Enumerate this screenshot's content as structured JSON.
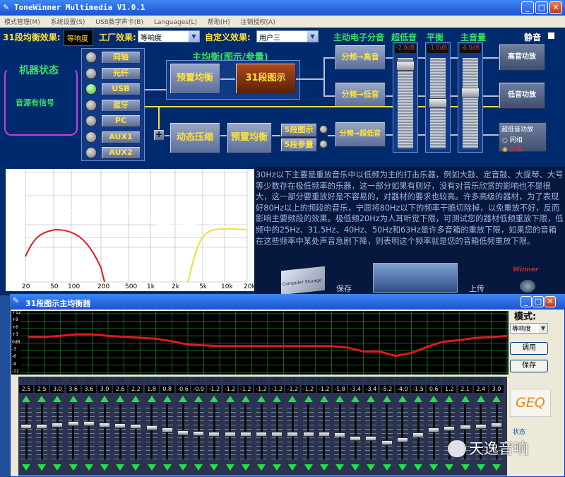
{
  "app": {
    "title": "ToneWinner Multimedia V1.0.1"
  },
  "menu": [
    "模式管理(M)",
    "系统设置(S)",
    "USB数字声卡(B)",
    "Languages(L)",
    "帮助(H)",
    "注销授权(A)"
  ],
  "top": {
    "eq31_label": "31段均衡效果:",
    "eq31_value": "等响度",
    "factory_label": "工厂效果:",
    "factory_value": "等响度",
    "custom_label": "自定义效果:",
    "custom_value": "用户三",
    "active_label": "主动电子分音",
    "subwoofer_label": "超低音",
    "balance_label": "平衡",
    "volume_label": "主音量",
    "mute_label": "静音"
  },
  "machine": {
    "title": "机器状态",
    "status": "音源有信号"
  },
  "sources": [
    {
      "label": "同轴",
      "active": false
    },
    {
      "label": "光纤",
      "active": false
    },
    {
      "label": "USB",
      "active": true
    },
    {
      "label": "蓝牙",
      "active": false
    },
    {
      "label": "PC",
      "active": false
    },
    {
      "label": "AUX1",
      "active": false
    },
    {
      "label": "AUX2",
      "active": false
    }
  ],
  "chain": {
    "main_eq_title": "主均衡(图示/参量)",
    "preset_eq": "预置均衡",
    "graphic31": "31段图示",
    "xover_high": "分频→高音",
    "xover_low": "分频→低音",
    "plus": "+",
    "compressor": "动态压缩",
    "preset_eq2": "预置均衡",
    "eq5_graphic": "5段图示",
    "eq5_param": "5段参量",
    "xover_sub": "分频→超低音"
  },
  "faders": {
    "sub_level": "-2.0dB",
    "bal_level": "-1.0dB",
    "vol_level": "-6.0dB"
  },
  "amps": {
    "high": "高音功放",
    "low": "低音功放",
    "sub_title": "超低音功放",
    "phase_in": "同相",
    "phase_rev": "反相"
  },
  "graph": {
    "ylabels": [
      "+10",
      "+5",
      "0",
      "-3",
      "-5",
      "-10"
    ],
    "ylabel_db": "dB",
    "xlabels": [
      "20",
      "50",
      "100",
      "200",
      "500",
      "1k",
      "2k",
      "5k",
      "10k",
      "20k"
    ],
    "xunit": "Hz"
  },
  "info_text": "30Hz以下主要是重放音乐中以低频为主的打击乐器，例如大鼓、定音鼓、大提琴、大号等少数存在极低频率的乐器，这一部分如果有则好，没有对音乐欣赏的影响也不是很大，这一部分要重放好是不容易的，对器材的要求也较高。许多高级的器材，为了表现好80Hz以上的频段的音乐，宁愿将80Hz以下的频率干脆切除掉，以免重放不好，反而影响主要频段的效果。极低频20Hz为人耳听觉下限，可测试您的器材低频重放下限，低频中的25Hz、31.5Hz、40Hz、50Hz和63Hz是许多音箱的重放下限，如果您的音箱在这些频率中某处声音急剧下降，则表明这个频率就是您的音箱低频重放下限。",
  "thumbs": {
    "caption": "Computer Storage",
    "brand": "Winner",
    "text1": "保存",
    "text2": "上传"
  },
  "dialog": {
    "title": "31段图示主均衡器",
    "mode_label": "模式:",
    "mode_value": "等响度",
    "btn_call": "调用",
    "btn_save": "保存",
    "geq": "GEQ",
    "status_label": "状态",
    "watermark": "天逸音响",
    "db_labels": [
      "+12",
      "+9",
      "+6",
      "+3",
      "0dB",
      "-3",
      "-6",
      "-9",
      "-12"
    ]
  },
  "eq_bands": [
    {
      "f": "22",
      "v": "2.5"
    },
    {
      "f": "27.5",
      "v": "2.5"
    },
    {
      "f": "34",
      "v": "3.0"
    },
    {
      "f": "43",
      "v": "3.6"
    },
    {
      "f": "54",
      "v": "3.6"
    },
    {
      "f": "67",
      "v": "3.0"
    },
    {
      "f": "84",
      "v": "2.6"
    },
    {
      "f": "105",
      "v": "2.2"
    },
    {
      "f": "132",
      "v": "1.8"
    },
    {
      "f": "165",
      "v": "0.8"
    },
    {
      "f": "202",
      "v": "-0.6"
    },
    {
      "f": "257",
      "v": "-0.9"
    },
    {
      "f": "322",
      "v": "-1.2"
    },
    {
      "f": "402",
      "v": "-1.2"
    },
    {
      "f": "503",
      "v": "-1.2"
    },
    {
      "f": "629",
      "v": "-1.2"
    },
    {
      "f": "787",
      "v": "-1.2"
    },
    {
      "f": "1K",
      "v": "-1.2"
    },
    {
      "f": "1.2K",
      "v": "-1.2"
    },
    {
      "f": "1.5K",
      "v": "-1.2"
    },
    {
      "f": "1.9K",
      "v": "-1.8"
    },
    {
      "f": "2.4K",
      "v": "-3.4"
    },
    {
      "f": "3K",
      "v": "-3.4"
    },
    {
      "f": "3.7K",
      "v": "-5.2"
    },
    {
      "f": "4.7K",
      "v": "-4.0"
    },
    {
      "f": "5.9K",
      "v": "-1.5"
    },
    {
      "f": "7.4K",
      "v": "0.6"
    },
    {
      "f": "9.2K",
      "v": "1.2"
    },
    {
      "f": "11.5K",
      "v": "2.1"
    },
    {
      "f": "14.4K",
      "v": "2.4"
    },
    {
      "f": "18K",
      "v": "3.0"
    }
  ],
  "colors": {
    "accent_yellow": "#ffe23a",
    "led_on": "#2cc22c",
    "eq_curve": "#e01818",
    "grid_green": "#1f8f2f"
  }
}
